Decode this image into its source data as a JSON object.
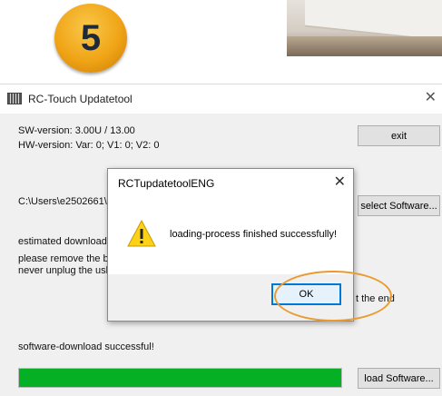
{
  "step_badge": "5",
  "window": {
    "title": "RC-Touch Updatetool",
    "sw_version": "SW-version: 3.00U / 13.00",
    "hw_version": "HW-version: Var: 0;  V1: 0;  V2: 0",
    "path": "C:\\Users\\e2502661\\D",
    "estimated_download": "estimated download-",
    "please_remove": "please remove the ba",
    "never_unplug": "never unplug the usb",
    "at_the_end": "t the end",
    "status": "software-download successful!",
    "progress_percent": 100,
    "buttons": {
      "exit": "exit",
      "select_software": "select Software...",
      "load_software": "load Software..."
    }
  },
  "dialog": {
    "title": "RCTupdatetoolENG",
    "message": "loading-process finished successfully!",
    "ok": "OK"
  },
  "colors": {
    "progress_fill": "#06b025",
    "highlight_ring": "#ea9a2f",
    "badge": "#f0a416",
    "ok_border": "#0078d7"
  }
}
